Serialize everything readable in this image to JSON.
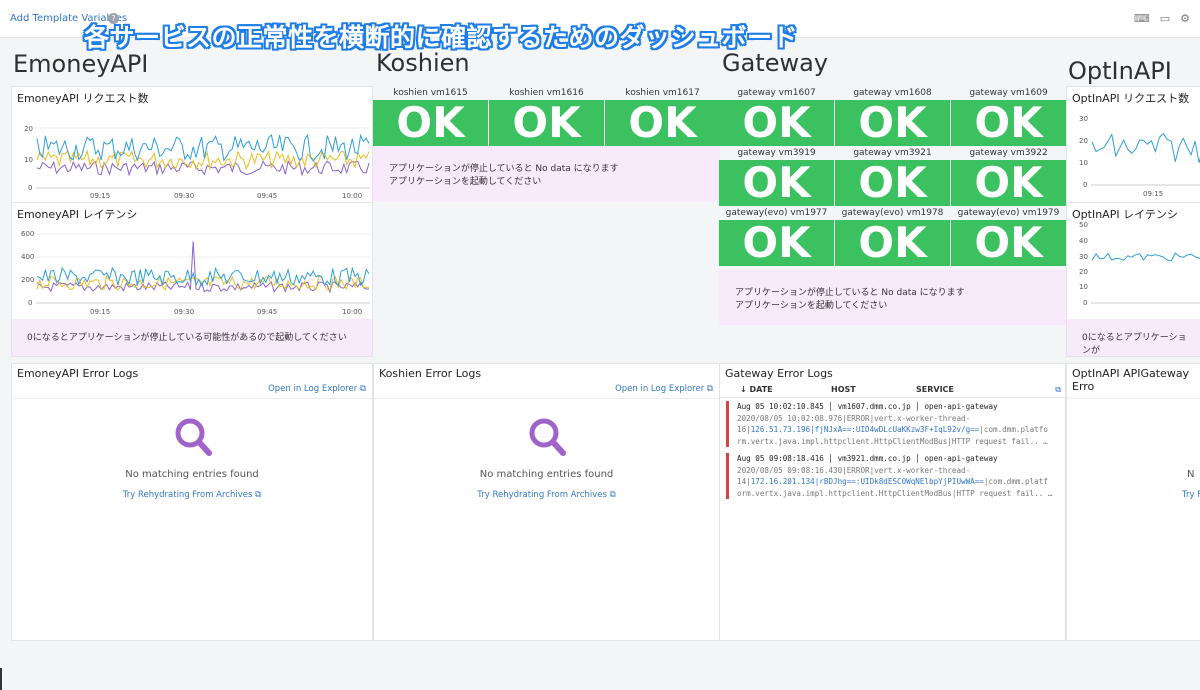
{
  "topbar": {
    "template_link": "Add Template Variables",
    "help": "?",
    "icons": [
      "keyboard-icon",
      "monitor-icon",
      "gear-icon"
    ]
  },
  "banner": "各サービスの正常性を横断的に確認するためのダッシュボード",
  "groups": {
    "emoney": "EmoneyAPI",
    "koshien": "Koshien",
    "gateway": "Gateway",
    "optin": "OptInAPI"
  },
  "emoney": {
    "req_title": "EmoneyAPI リクエスト数",
    "req_yticks": [
      "20",
      "10",
      "0"
    ],
    "xticks": [
      "09:15",
      "09:30",
      "09:45",
      "10:00"
    ],
    "lat_title": "EmoneyAPI レイテンシ",
    "lat_yticks": [
      "600",
      "400",
      "200",
      "0"
    ],
    "note": "0になるとアプリケーションが停止している可能性があるので起動してください"
  },
  "koshien": {
    "hosts": [
      "koshien vm1615",
      "koshien vm1616",
      "koshien vm1617"
    ],
    "note_line1": "アプリケーションが停止していると No data になります",
    "note_line2": "アプリケーションを起動してください"
  },
  "gateway": {
    "rows": [
      [
        "gateway vm1607",
        "gateway vm1608",
        "gateway vm1609"
      ],
      [
        "gateway vm3919",
        "gateway vm3921",
        "gateway vm3922"
      ],
      [
        "gateway(evo) vm1977",
        "gateway(evo) vm1978",
        "gateway(evo) vm1979"
      ]
    ],
    "note_line1": "アプリケーションが停止していると No data になります",
    "note_line2": "アプリケーションを起動してください"
  },
  "status_ok": "OK",
  "optin": {
    "req_title": "OptInAPI リクエスト数",
    "req_yticks": [
      "30",
      "20",
      "10",
      "0"
    ],
    "xtick": "09:15",
    "lat_title": "OptInAPI レイテンシ",
    "lat_yticks": [
      "50",
      "40",
      "30",
      "20",
      "10",
      "0"
    ],
    "note": "0になるとアプリケーションが"
  },
  "logs": {
    "emoney_title": "EmoneyAPI Error Logs",
    "koshien_title": "Koshien Error Logs",
    "gateway_title": "Gateway Error Logs",
    "optin_title": "OptInAPI APIGateway Erro",
    "open_link": "Open in Log Explorer",
    "empty": "No matching entries found",
    "rehydrate": "Try Rehydrating From Archives",
    "optin_partial_1": "N",
    "optin_partial_2": "Try F",
    "col_date": "↓ DATE",
    "col_host": "HOST",
    "col_service": "SERVICE",
    "entries": [
      {
        "meta": "Aug 05 10:02:10.845 │ vm1607.dmm.co.jp │ open-api-gateway",
        "l1": "2020/08/05 10:02:08.976|ERROR|vert.x-worker-thread-",
        "l2a": "16|",
        "l2ip": "126.51.73.196|fjNJxA==:UID4wDLcUaKKzw3F+IqL92v/g==",
        "l2b": "|com.dmm.platfo",
        "l3": "rm.vertx.java.impl.httpclient.HttpClientModBus|HTTP request fail.. …"
      },
      {
        "meta": "Aug 05 09:08:18.416 │ vm3921.dmm.co.jp │ open-api-gateway",
        "l1": "2020/08/05 09:08:16.430|ERROR|vert.x-worker-thread-",
        "l2a": "14|",
        "l2ip": "172.16.201.134|rBDJhg==:UIDk8dESC0WqNElbpYjPIUwWA==",
        "l2b": "|com.dmm.platf",
        "l3": "orm.vertx.java.impl.httpclient.HttpClientModBus|HTTP request fail.. …"
      }
    ]
  },
  "colors": {
    "ok_green": "#3cc160",
    "series_blue": "#2f9fd8",
    "series_yellow": "#e6c020",
    "series_purple": "#8a63c9",
    "note_bg": "#f9eafb",
    "banner_stroke": "#1e7de6"
  }
}
